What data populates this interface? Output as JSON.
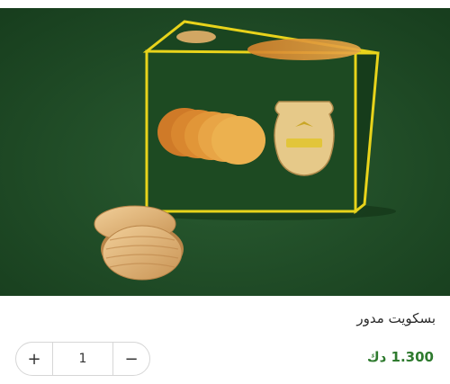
{
  "product": {
    "title": "بسكويت مدور",
    "price": "1.300 دك",
    "image_alt": "box-of-round-biscuits-photo"
  },
  "quantity": {
    "value": "1",
    "increase_label": "+",
    "decrease_label": "−"
  },
  "colors": {
    "background_green": "#1f4a26",
    "price_green": "#2e7a2e",
    "box_border_yellow": "#e8d31b"
  }
}
